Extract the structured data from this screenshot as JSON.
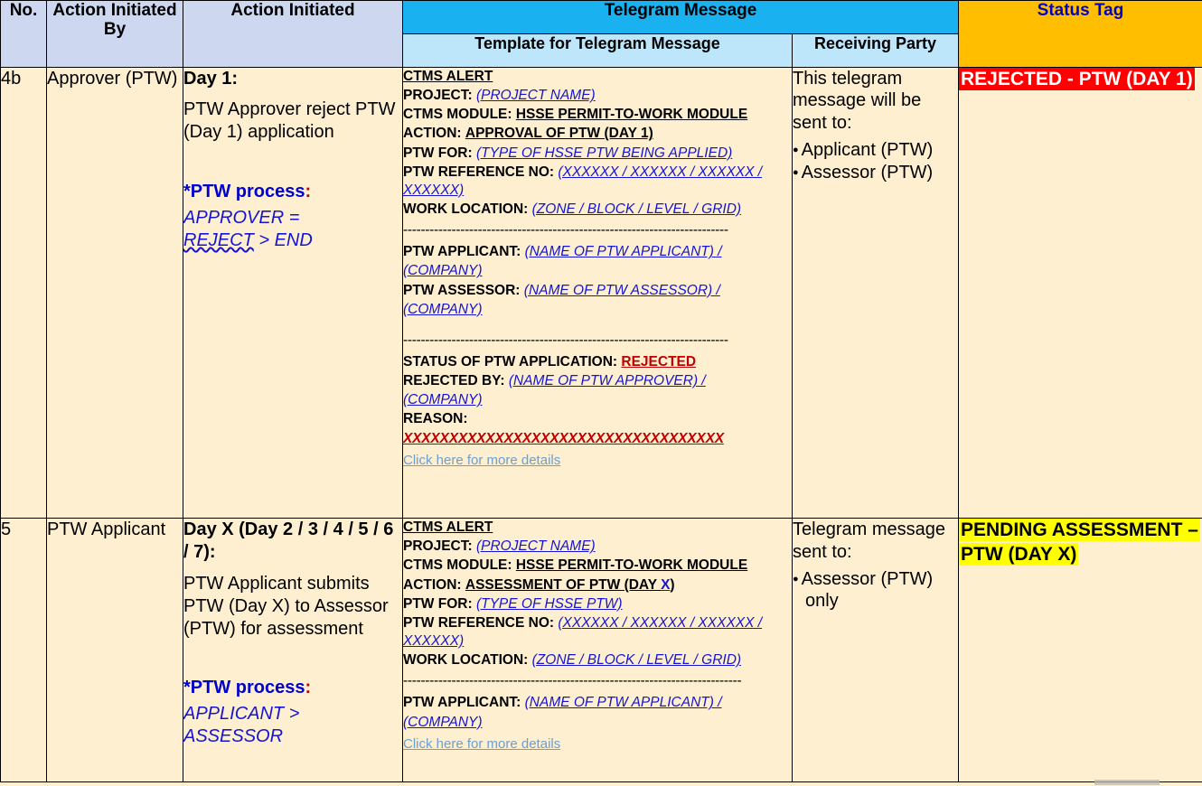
{
  "table": {
    "headers": {
      "no": "No.",
      "action_initiated_by": "Action Initiated By",
      "action_initiated": "Action Initiated",
      "telegram_message": "Telegram Message",
      "template_for_telegram_message": "Template for Telegram Message",
      "receiving_party": "Receiving Party",
      "status_tag": "Status Tag"
    },
    "colors": {
      "header_bg": "#cdd8f0",
      "telegram_header_bg": "#19b1ef",
      "telegram_sub_header_bg": "#bde6fb",
      "status_header_bg": "#ffbf00",
      "status_header_text": "#0000cd",
      "body_bg": "#fdefd0",
      "rejected_tag_bg": "#ff0000",
      "rejected_tag_text": "#ffffff",
      "pending_tag_bg": "#ffff00",
      "pending_tag_text": "#000000",
      "blue_placeholder": "#1414d2",
      "red_accent": "#c00000",
      "link": "#6b9fd2"
    },
    "rows": [
      {
        "no": "4b",
        "initiated_by": "Approver (PTW)",
        "action": {
          "title": "Day 1:",
          "body": "PTW Approver reject PTW (Day 1) application",
          "process_label": "*PTW process",
          "process_colon": ":",
          "process_flow_line1": "APPROVER = ",
          "process_flow_line2": "REJECT",
          "process_flow_line3": " > END"
        },
        "template": {
          "alert": "CTMS ALERT",
          "project_label": "PROJECT:",
          "project_value": "(PROJECT NAME)",
          "module_label": "CTMS MODULE:",
          "module_value": "HSSE PERMIT-TO-WORK MODULE",
          "action_label": "ACTION:",
          "action_value": "APPROVAL OF PTW (DAY 1)",
          "ptw_for_label": "PTW FOR:",
          "ptw_for_value": "(TYPE OF HSSE PTW BEING APPLIED)",
          "ref_label": "PTW REFERENCE NO:",
          "ref_value": "(XXXXXX / XXXXXX / XXXXXX / XXXXXX)",
          "location_label": "WORK LOCATION:",
          "location_value": "(ZONE / BLOCK / LEVEL / GRID)",
          "divider1": "--------------------------------------------------------------------------",
          "applicant_label": "PTW APPLICANT:",
          "applicant_value": "(NAME OF PTW APPLICANT) /",
          "applicant_company": "(COMPANY)",
          "assessor_label": "PTW ASSESSOR:",
          "assessor_value": "(NAME OF PTW ASSESSOR) /",
          "assessor_company": "(COMPANY)",
          "divider2": "--------------------------------------------------------------------------",
          "status_label": "STATUS OF PTW APPLICATION:",
          "status_value": "REJECTED",
          "rejected_by_label": "REJECTED BY:",
          "rejected_by_value": "(NAME OF PTW APPROVER) /",
          "rejected_by_company": "(COMPANY)",
          "reason_label": "REASON:",
          "reason_value": "XXXXXXXXXXXXXXXXXXXXXXXXXXXXXXXXXXX",
          "link": "Click here for more details"
        },
        "receiving": {
          "lead": "This telegram message will be sent to:",
          "items": [
            "Applicant (PTW)",
            "Assessor (PTW)"
          ]
        },
        "status_tag": "REJECTED - PTW (DAY 1)",
        "status_tag_style": "rejected"
      },
      {
        "no": "5",
        "initiated_by": "PTW Applicant",
        "action": {
          "title": "Day X (Day 2 / 3 / 4 / 5 / 6 / 7):",
          "body": "PTW Applicant submits PTW (Day X) to Assessor (PTW) for assessment",
          "process_label": "*PTW process",
          "process_colon": ":",
          "process_flow_line1": "APPLICANT > ",
          "process_flow_line2": "ASSESSOR",
          "process_flow_line3": ""
        },
        "template": {
          "alert": "CTMS ALERT",
          "project_label": "PROJECT:",
          "project_value": "(PROJECT NAME)",
          "module_label": "CTMS MODULE:",
          "module_value": "HSSE PERMIT-TO-WORK MODULE",
          "action_label": "ACTION:",
          "action_value_pre": "ASSESSMENT OF PTW (DAY ",
          "action_value_x": "X",
          "action_value_post": ")",
          "ptw_for_label": "PTW FOR:",
          "ptw_for_value": "(TYPE OF HSSE PTW)",
          "ref_label": "PTW REFERENCE NO:",
          "ref_value": "(XXXXXX / XXXXXX / XXXXXX / XXXXXX)",
          "location_label": "WORK LOCATION:",
          "location_value": "(ZONE / BLOCK / LEVEL / GRID)",
          "divider1": "-----------------------------------------------------------------------------",
          "applicant_label": "PTW APPLICANT:",
          "applicant_value": "(NAME OF PTW APPLICANT) /",
          "applicant_company": "(COMPANY)",
          "link": "Click here for more details"
        },
        "receiving": {
          "lead": "Telegram message sent to:",
          "items": [
            "Assessor (PTW) only"
          ]
        },
        "status_tag": "PENDING ASSESSMENT – PTW (DAY X)",
        "status_tag_style": "pending"
      }
    ]
  }
}
